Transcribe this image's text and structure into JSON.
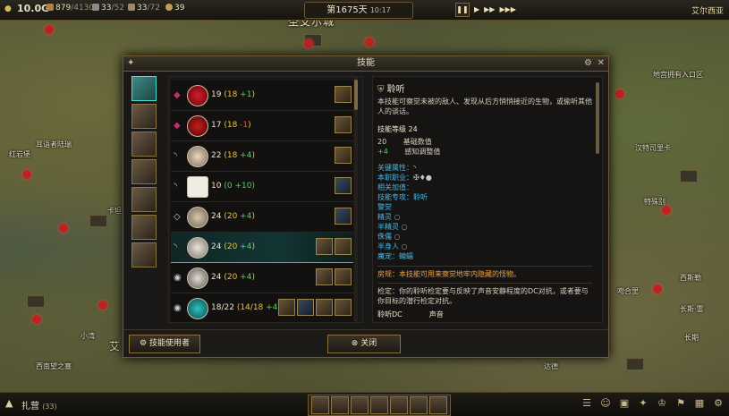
{
  "topbar": {
    "gold": "10.0G",
    "stat1": "879",
    "stat1_max": "/4130",
    "stat2": "33",
    "stat2_max": "/52",
    "stat3": "33",
    "stat3_max": "/72",
    "stat4": "39",
    "date": "第1675天",
    "time": "10:17",
    "region": "艾尔西亚",
    "city_banner": "圣艾尔城"
  },
  "map_labels": [
    "卡坦",
    "耳语者陆瑞",
    "红岩堡",
    "小湾",
    "地宫拥有入口区",
    "艾",
    "西南望之塞",
    "汉特司里卡",
    "长斯·雷",
    "吻合里",
    "西斯勒",
    "特殊别",
    "长期",
    "达德"
  ],
  "modal": {
    "title": "技能",
    "skills": [
      {
        "base": "19",
        "total": "18",
        "mod": "+1",
        "mod_type": "g"
      },
      {
        "base": "17",
        "total": "18",
        "mod": "-1",
        "mod_type": "r"
      },
      {
        "base": "22",
        "total": "18",
        "mod": "+4",
        "mod_type": "g"
      },
      {
        "base": "10",
        "total": "0",
        "mod": "+10",
        "mod_type": "g"
      },
      {
        "base": "24",
        "total": "20",
        "mod": "+4",
        "mod_type": "g"
      },
      {
        "base": "24",
        "total": "20",
        "mod": "+4",
        "mod_type": "g"
      },
      {
        "base": "24",
        "total": "20",
        "mod": "+4",
        "mod_type": "g"
      },
      {
        "base": "18/22",
        "total": "14/18",
        "mod": "+4",
        "mod_type": "g"
      }
    ],
    "detail": {
      "name": "聆听",
      "desc": "本技能可察觉未被的敌人、发现从后方悄悄接近的生物，或偷听其他人的谈话。",
      "level_label": "技能等级 24",
      "base_val": "20",
      "base_label": "基础数值",
      "mod_val": "+4",
      "mod_label": "感知调整值",
      "key_attr": "关键属性：",
      "class": "本职职业：",
      "bonus": "相关加值：",
      "specialty": "技能专攻：聆听",
      "r1": "警觉",
      "r2": "精灵",
      "r3": "半精灵",
      "r4": "侏儒",
      "r5": "半身人",
      "r6": "魔宠：蝙蝠",
      "note": "房规：本技能可用来察觉地牢内隐藏的怪物。",
      "check": "检定：你的聆听检定要与反映了声音安静程度的DC对抗，或者要与你目标的潜行检定对抗。",
      "col1": "聆听DC",
      "col2": "声音"
    },
    "users_button": "技能使用者",
    "close_button": "关闭"
  },
  "bottom": {
    "camp": "扎营",
    "camp_count": "(33)"
  },
  "colors": {
    "accent": "#24c8c0",
    "frame": "#6e5a33"
  }
}
